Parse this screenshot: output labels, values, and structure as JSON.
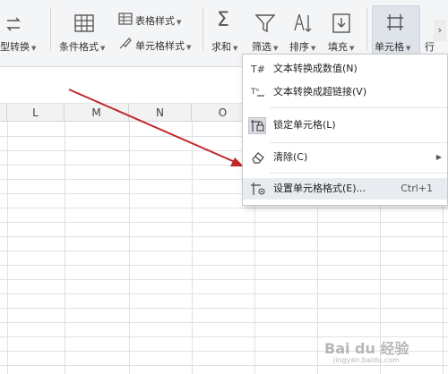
{
  "ribbon": {
    "type_convert_label": "型转换",
    "conditional_format_label": "条件格式",
    "table_style_label": "表格样式",
    "cell_style_label": "单元格样式",
    "sum_label": "求和",
    "filter_label": "筛选",
    "sort_label": "排序",
    "fill_label": "填充",
    "cell_label": "单元格",
    "row_label": "行"
  },
  "columns": [
    "L",
    "M",
    "N",
    "O"
  ],
  "context_menu": {
    "items": [
      {
        "label": "文本转换成数值(N)"
      },
      {
        "label": "文本转换成超链接(V)"
      },
      {
        "label": "锁定单元格(L)"
      },
      {
        "label": "清除(C)"
      },
      {
        "label": "设置单元格格式(E)...",
        "shortcut": "Ctrl+1"
      }
    ]
  },
  "watermark": {
    "text": "Bai du 经验",
    "subtext": "jingyan.baidu.com"
  },
  "colors": {
    "arrow": "#c0282b",
    "menu_highlight": "#e8ebef",
    "ribbon_bg": "#f4f5f7"
  }
}
